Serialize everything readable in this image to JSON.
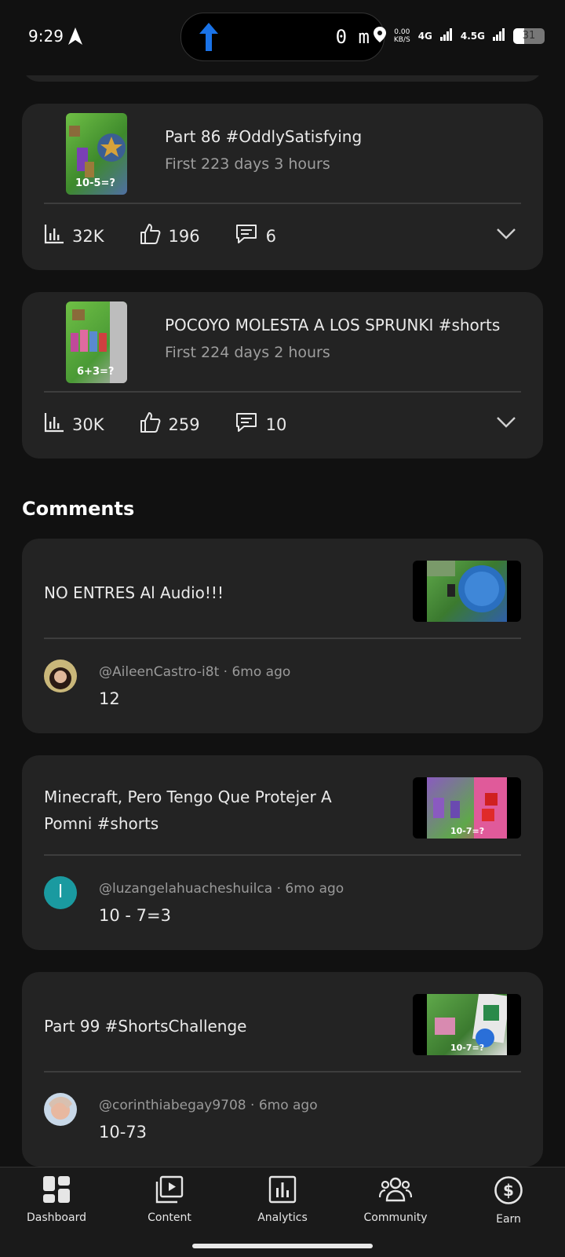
{
  "status_bar": {
    "time": "9:29",
    "nav_distance": "0 m",
    "data_rate_top": "0.00",
    "data_rate_unit": "KB/S",
    "net1": "4G",
    "net2": "4.5G",
    "battery": "31"
  },
  "videos": [
    {
      "title": "Part 86 #OddlySatisfying",
      "subtitle": "First 223 days 3 hours",
      "thumb_label": "10-5=?",
      "views": "32K",
      "likes": "196",
      "comments": "6"
    },
    {
      "title": "POCOYO MOLESTA A LOS SPRUNKI #shorts",
      "subtitle": "First 224 days 2 hours",
      "thumb_label": "6+3=?",
      "views": "30K",
      "likes": "259",
      "comments": "10"
    }
  ],
  "comments_section": {
    "title": "Comments",
    "items": [
      {
        "video_title": "NO ENTRES Al Audio!!!",
        "author": "@AileenCastro-i8t",
        "age": "6mo ago",
        "text": "12",
        "avatar_letter": ""
      },
      {
        "video_title": "Minecraft, Pero Tengo Que Protejer A Pomni #shorts",
        "author": "@luzangelahuacheshuilca",
        "age": "6mo ago",
        "text": "10 - 7=3",
        "avatar_letter": "l",
        "thumb_label": "10-7=?"
      },
      {
        "video_title": "Part 99 #ShortsChallenge",
        "author": "@corinthiabegay9708",
        "age": "6mo ago",
        "text": "10-73",
        "avatar_letter": "",
        "thumb_label": "10-7=?"
      }
    ],
    "separator": "·"
  },
  "bottom_nav": {
    "items": [
      {
        "label": "Dashboard",
        "icon": "dashboard-icon"
      },
      {
        "label": "Content",
        "icon": "content-icon"
      },
      {
        "label": "Analytics",
        "icon": "analytics-icon"
      },
      {
        "label": "Community",
        "icon": "community-icon"
      },
      {
        "label": "Earn",
        "icon": "earn-icon"
      }
    ]
  },
  "colors": {
    "background": "#111111",
    "card": "#232323",
    "accent_arrow": "#1a73e8",
    "avatar_teal": "#1a9aa0"
  }
}
